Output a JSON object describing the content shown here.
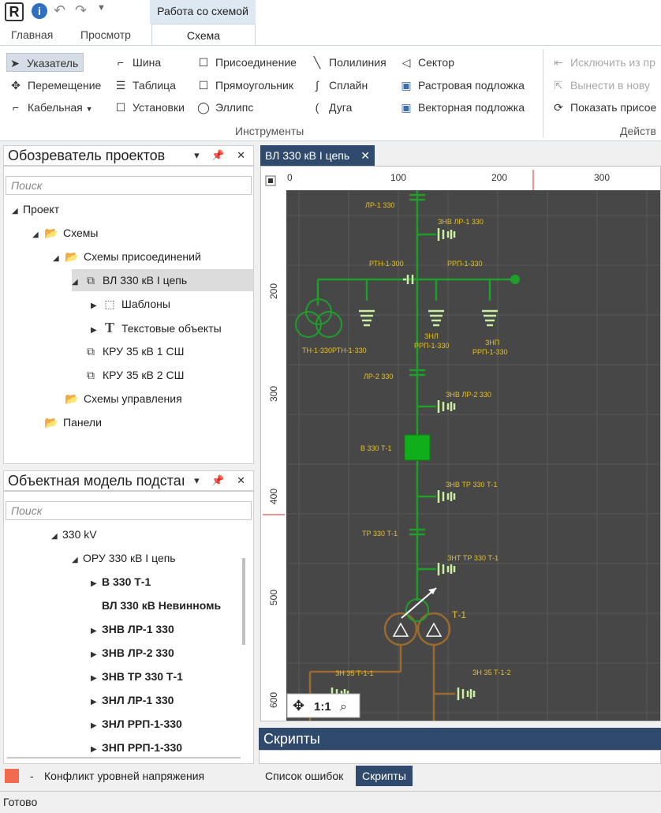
{
  "ribbon": {
    "context_tab": "Работа со схемой",
    "tabs": [
      "Главная",
      "Просмотр",
      "Схема"
    ],
    "tools_col1": [
      "Указатель",
      "Перемещение",
      "Кабельная"
    ],
    "tools_col2": [
      "Шина",
      "Таблица",
      "Установки"
    ],
    "tools_col3": [
      "Присоединение",
      "Прямоугольник",
      "Эллипс"
    ],
    "tools_col4": [
      "Полилиния",
      "Сплайн",
      "Дуга"
    ],
    "tools_col5": [
      "Сектор",
      "Растровая подложка",
      "Векторная подложка"
    ],
    "actions": [
      "Исключить из пр",
      "Вынести в нову",
      "Показать присое"
    ],
    "group_tools": "Инструменты",
    "group_actions": "Действ"
  },
  "project_explorer": {
    "title": "Обозреватель проектов",
    "search_placeholder": "Поиск",
    "items": [
      "Проект",
      "Схемы",
      "Схемы присоединений",
      "ВЛ 330 кВ I цепь",
      "Шаблоны",
      "Текстовые объекты",
      "КРУ 35 кВ 1 СШ",
      "КРУ 35 кВ 2 СШ",
      "Схемы управления",
      "Панели"
    ]
  },
  "object_model": {
    "title": "Объектная модель подстаı",
    "search_placeholder": "Поиск",
    "items": [
      "330 kV",
      "ОРУ 330 кВ I цепь",
      "В 330 Т-1",
      "ВЛ 330 кВ Невинномь",
      "ЗНВ ЛР-1 330",
      "ЗНВ ЛР-2 330",
      "ЗНВ ТР 330 Т-1",
      "ЗНЛ ЛР-1 330",
      "ЗНЛ РРП-1-330",
      "ЗНП РРП-1-330"
    ]
  },
  "legend": {
    "dash": "-",
    "text": "Конфликт уровней напряжения",
    "color": "#f26b4f"
  },
  "document": {
    "tab_title": "ВЛ 330 кВ I цепь",
    "ruler_x": [
      "0",
      "100",
      "200",
      "300"
    ],
    "ruler_y": [
      "200",
      "300",
      "400",
      "500",
      "600"
    ],
    "zoom_label": "1:1",
    "labels": {
      "lr1": "ЛР-1 330",
      "znv_lr1": "ЗНВ ЛР-1 330",
      "rtn": "РТН-1-300",
      "rrp": "РРП-1-330",
      "tn": "ТН-1-330",
      "rtn2": "РТН-1-330",
      "znl": "ЗНЛ",
      "znl2": "РРП-1-330",
      "znp": "ЗНП",
      "znp2": "РРП-1-330",
      "lr2": "ЛР-2 330",
      "znv_lr2": "ЗНВ ЛР-2 330",
      "v330": "В 330 Т-1",
      "znv_tr": "ЗНВ ТР 330 Т-1",
      "tr": "ТР 330 Т-1",
      "znt": "ЗНТ ТР 330 Т-1",
      "t1": "Т-1",
      "zn35_1": "ЗН 35 Т-1-1",
      "zn35_2": "ЗН 35 Т-1-2"
    }
  },
  "bottom": {
    "scripts_title": "Скрипты",
    "tabs": [
      "Список ошибок",
      "Скрипты"
    ]
  },
  "status": "Готово",
  "colors": {
    "accent": "#2f4a6d",
    "canvas": "#474747",
    "wire": "#1f9e2a",
    "label": "#e8c21a",
    "cable": "#9b6a2f"
  }
}
